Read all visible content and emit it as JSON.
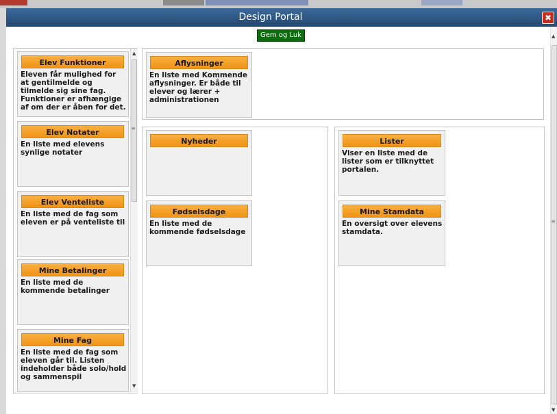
{
  "dialog": {
    "title": "Design Portal",
    "save_label": "Gem og Luk",
    "close_label": "✖"
  },
  "left_list": [
    {
      "title": "Elev Funktioner",
      "desc": "Eleven får mulighed for at gentilmelde og tilmelde sig sine fag. Funktioner er afhængige af om der er åben for det."
    },
    {
      "title": "Elev Notater",
      "desc": "En liste med elevens synlige notater"
    },
    {
      "title": "Elev Venteliste",
      "desc": "En liste med de fag som eleven er på venteliste til"
    },
    {
      "title": "Mine Betalinger",
      "desc": "En liste med de kommende betalinger"
    },
    {
      "title": "Mine Fag",
      "desc": "En liste med de fag som eleven går til. Listen indeholder både solo/hold og sammenspil"
    }
  ],
  "top_zone": [
    {
      "title": "Aflysninger",
      "desc": "En liste med Kommende aflysninger. Er både til elever og lærer + administrationen"
    }
  ],
  "mid_zone": [
    {
      "title": "Nyheder",
      "desc": ""
    },
    {
      "title": "Fødselsdage",
      "desc": "En liste med de kommende fødselsdage"
    }
  ],
  "right_zone": [
    {
      "title": "Lister",
      "desc": "Viser en liste med de lister som er tilknyttet portalen."
    },
    {
      "title": "Mine Stamdata",
      "desc": "En oversigt over elevens stamdata."
    }
  ],
  "colors": {
    "titlebar": "#2f5b87",
    "card_header": "#f3a12a",
    "save_button": "#0f6b0f",
    "close_button": "#c62b1b"
  }
}
